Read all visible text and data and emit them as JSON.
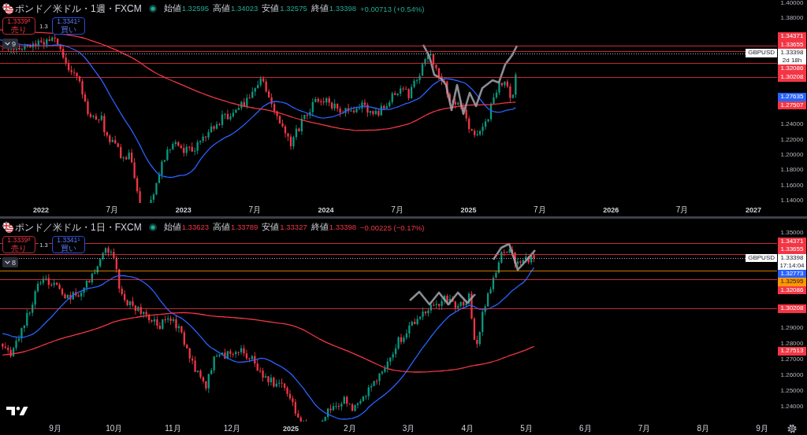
{
  "panes": [
    {
      "legend": {
        "title": "ポンド／米ドル・1週・FXCM",
        "market_open": true,
        "rising": true,
        "ohlc": [
          {
            "label": "始値",
            "value": "1.32595"
          },
          {
            "label": "高値",
            "value": "1.34023"
          },
          {
            "label": "安値",
            "value": "1.32575"
          },
          {
            "label": "終値",
            "value": "1.33398"
          }
        ],
        "change": "+0.00713 (+0.54%)"
      },
      "trade": {
        "sell": {
          "price": "1.3339$^{8}$",
          "label": "売り"
        },
        "spread": "1.3",
        "buy": {
          "price": "1.3341$^{1}$",
          "label": "買い"
        }
      },
      "indicators": {
        "count": "9"
      },
      "price_axis": [
        "1.40000",
        "1.38000",
        "1.24000",
        "1.22000",
        "1.20000",
        "1.18000",
        "1.16000",
        "1.14000"
      ],
      "markers": [
        {
          "kind": "level",
          "text": "1.34371",
          "color": "#f23645"
        },
        {
          "kind": "level",
          "text": "1.33655",
          "color": "#f23645"
        },
        {
          "kind": "price",
          "symbol": "GBPUSD",
          "text": "1.33398",
          "countdown": "2d 18h"
        },
        {
          "kind": "level",
          "text": "1.32086",
          "color": "#f23645"
        },
        {
          "kind": "level",
          "text": "1.30208",
          "color": "#f23645"
        },
        {
          "kind": "average",
          "text": "1.27635",
          "color": "#2962ff"
        },
        {
          "kind": "average",
          "text": "1.27507",
          "color": "#f23645"
        }
      ],
      "time_axis": [
        {
          "kind": "year",
          "text": "2022"
        },
        {
          "kind": "month",
          "text": "7月"
        },
        {
          "kind": "year",
          "text": "2023"
        },
        {
          "kind": "month",
          "text": "7月"
        },
        {
          "kind": "year",
          "text": "2024"
        },
        {
          "kind": "month",
          "text": "7月"
        },
        {
          "kind": "year",
          "text": "2025"
        },
        {
          "kind": "month",
          "text": "7月"
        },
        {
          "kind": "year",
          "text": "2026"
        },
        {
          "kind": "month",
          "text": "7月"
        },
        {
          "kind": "year",
          "text": "2027"
        }
      ]
    },
    {
      "legend": {
        "title": "ポンド／米ドル・1日・FXCM",
        "market_open": true,
        "rising": false,
        "ohlc": [
          {
            "label": "始値",
            "value": "1.33623"
          },
          {
            "label": "高値",
            "value": "1.33789"
          },
          {
            "label": "安値",
            "value": "1.33327"
          },
          {
            "label": "終値",
            "value": "1.33398"
          }
        ],
        "change": "−0.00225 (−0.17%)"
      },
      "trade": {
        "sell": {
          "price": "1.3339$^{8}$",
          "label": "売り"
        },
        "spread": "1.3",
        "buy": {
          "price": "1.3341$^{1}$",
          "label": "買い"
        }
      },
      "indicators": {
        "count": "8"
      },
      "price_axis": [
        "1.35000",
        "1.29000",
        "1.28000",
        "1.27000",
        "1.26000",
        "1.25000",
        "1.24000"
      ],
      "markers": [
        {
          "kind": "level",
          "text": "1.34371",
          "color": "#f23645"
        },
        {
          "kind": "level",
          "text": "1.33655",
          "color": "#f23645"
        },
        {
          "kind": "price",
          "symbol": "GBPUSD",
          "text": "1.33398",
          "countdown": "17:14:04"
        },
        {
          "kind": "average",
          "text": "1.32773",
          "color": "#2962ff"
        },
        {
          "kind": "level",
          "text": "1.32595",
          "color": "#ff9800"
        },
        {
          "kind": "level",
          "text": "1.32086",
          "color": "#f23645"
        },
        {
          "kind": "level",
          "text": "1.30208",
          "color": "#f23645"
        },
        {
          "kind": "average",
          "text": "1.27513",
          "color": "#f23645"
        }
      ],
      "time_axis": [
        {
          "kind": "month",
          "text": "9月"
        },
        {
          "kind": "month",
          "text": "10月"
        },
        {
          "kind": "month",
          "text": "11月"
        },
        {
          "kind": "month",
          "text": "12月"
        },
        {
          "kind": "year",
          "text": "2025"
        },
        {
          "kind": "month",
          "text": "2月"
        },
        {
          "kind": "month",
          "text": "3月"
        },
        {
          "kind": "month",
          "text": "4月"
        },
        {
          "kind": "month",
          "text": "5月"
        },
        {
          "kind": "month",
          "text": "6月"
        },
        {
          "kind": "month",
          "text": "7月"
        },
        {
          "kind": "month",
          "text": "8月"
        },
        {
          "kind": "month",
          "text": "9月"
        }
      ]
    }
  ]
}
